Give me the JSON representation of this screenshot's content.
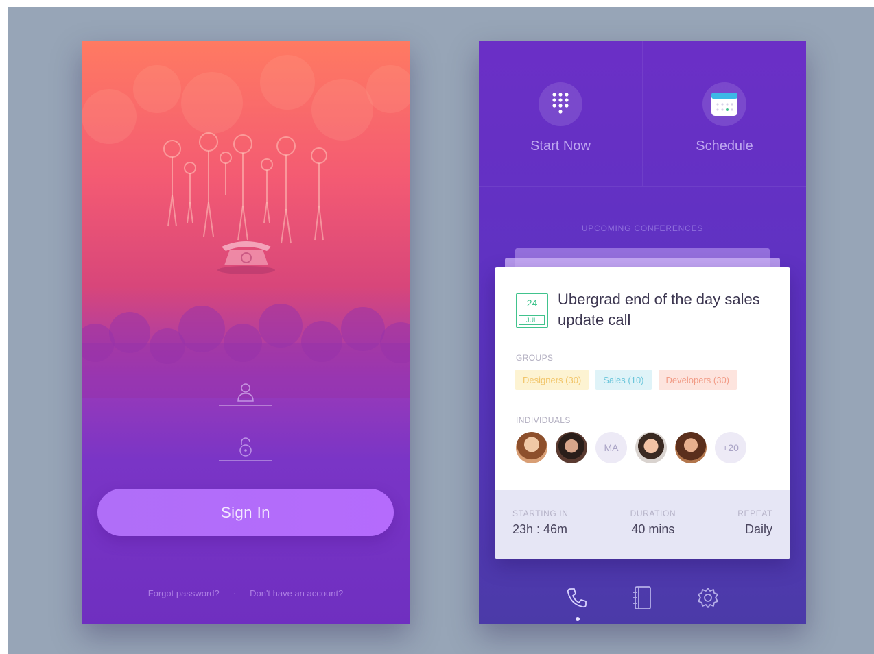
{
  "signin_screen": {
    "signin_label": "Sign In",
    "forgot_password": "Forgot password?",
    "separator": "·",
    "no_account": "Don't have an account?"
  },
  "dashboard_screen": {
    "actions": [
      {
        "label": "Start Now",
        "icon": "dialpad-icon"
      },
      {
        "label": "Schedule",
        "icon": "calendar-icon"
      }
    ],
    "upcoming_label": "UPCOMING CONFERENCES",
    "conference": {
      "date_day": "24",
      "date_month": "JUL",
      "title": "Ubergrad end of the day sales update call",
      "groups_label": "GROUPS",
      "groups": [
        "Designers (30)",
        "Sales (10)",
        "Developers (30)"
      ],
      "individuals_label": "INDIVIDUALS",
      "initials_avatar": "MA",
      "more_count": "+20",
      "starting_label": "STARTING IN",
      "starting_value": "23h : 46m",
      "duration_label": "DURATION",
      "duration_value": "40 mins",
      "repeat_label": "REPEAT",
      "repeat_value": "Daily"
    },
    "tabs": [
      "call-icon",
      "contacts-book-icon",
      "settings-gear-icon"
    ]
  },
  "colors": {
    "backdrop": "#97a5b7",
    "signin_gradient_top": "#ff7a62",
    "signin_gradient_bottom": "#6f2fc0",
    "dashboard_bg": "#5f32c2",
    "signin_button": "#b06ef8",
    "calendar_green": "#41c38d",
    "chip_designers": "#fdf3d2",
    "chip_sales": "#dff3f8",
    "chip_developers": "#fde4de"
  }
}
